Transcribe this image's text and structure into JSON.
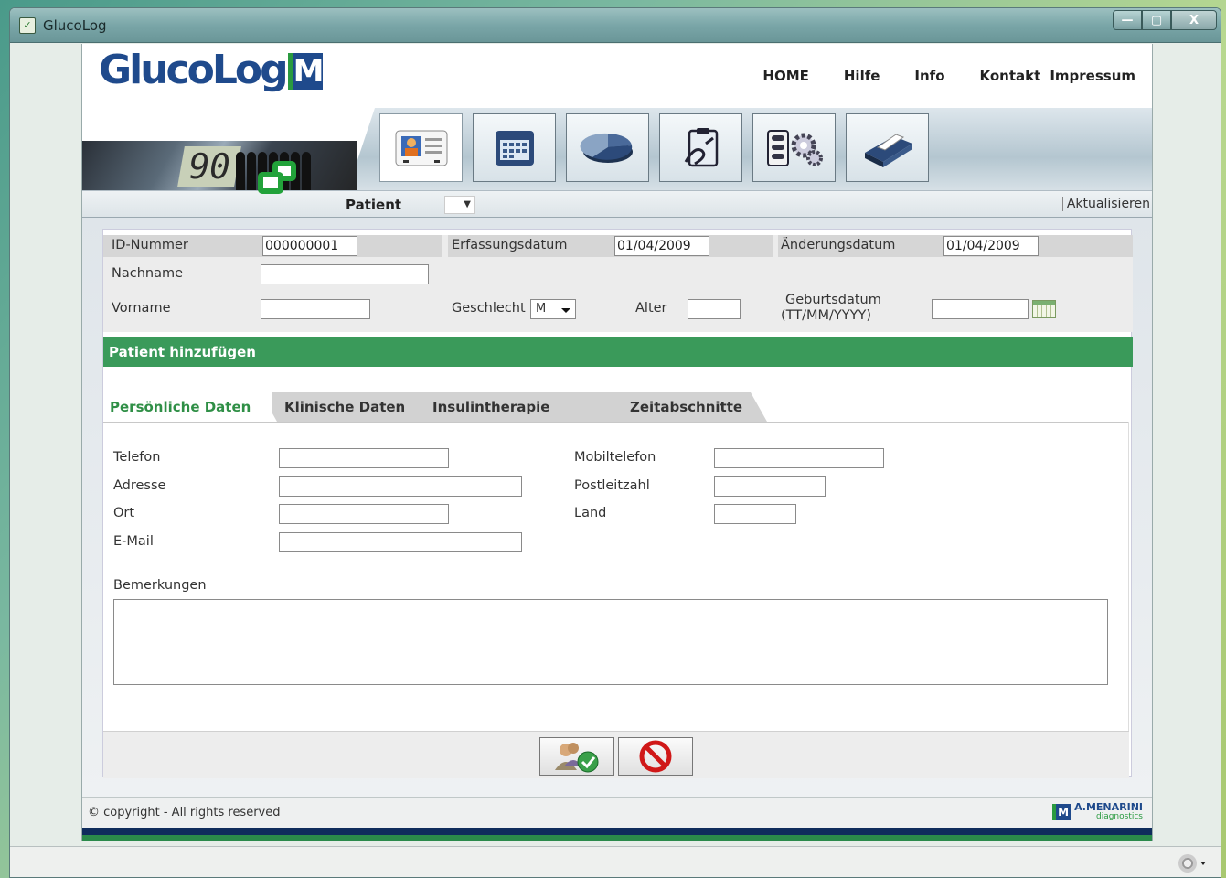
{
  "window": {
    "title": "GlucoLog",
    "controls": [
      "—",
      "▢",
      "X"
    ]
  },
  "app": {
    "logo": {
      "text": "GlucoLog",
      "mark": "M"
    },
    "nav": [
      "HOME",
      "Hilfe",
      "Info",
      "Kontakt",
      "Impressum"
    ],
    "toolbar_icons": [
      "patient-card-icon",
      "calendar-icon",
      "pie-chart-icon",
      "clipboard-icon",
      "settings-gear-icon",
      "printer-icon"
    ],
    "meter_reading": "90",
    "patient_label": "Patient",
    "refresh_label": "Aktualisieren"
  },
  "patient": {
    "id_label": "ID-Nummer",
    "id_value": "000000001",
    "created_label": "Erfassungsdatum",
    "created_value": "01/04/2009",
    "changed_label": "Änderungsdatum",
    "changed_value": "01/04/2009",
    "lastname_label": "Nachname",
    "lastname_value": "",
    "firstname_label": "Vorname",
    "firstname_value": "",
    "gender_label": "Geschlecht",
    "gender_value": "M",
    "age_label": "Alter",
    "age_value": "",
    "dob_label_1": "Geburtsdatum",
    "dob_label_2": "(TT/MM/YYYY)",
    "dob_value": ""
  },
  "section_title": "Patient hinzufügen",
  "tabs": [
    "Persönliche Daten",
    "Klinische Daten",
    "Insulintherapie",
    "Zeitabschnitte"
  ],
  "personal": {
    "phone_label": "Telefon",
    "phone_value": "",
    "mobile_label": "Mobiltelefon",
    "mobile_value": "",
    "address_label": "Adresse",
    "address_value": "",
    "zip_label": "Postleitzahl",
    "zip_value": "",
    "city_label": "Ort",
    "city_value": "",
    "country_label": "Land",
    "country_value": "",
    "email_label": "E-Mail",
    "email_value": "",
    "notes_label": "Bemerkungen",
    "notes_value": ""
  },
  "actions": {
    "save_icon": "add-patient-check-icon",
    "cancel_icon": "cancel-no-icon"
  },
  "footer": {
    "copyright": "© copyright - All rights reserved",
    "brand": "A.MENARINI",
    "brand_sub": "diagnostics"
  },
  "colors": {
    "accent_green": "#3a9a5a",
    "brand_blue": "#1f4a8c",
    "active_tab": "#2f8f46"
  }
}
